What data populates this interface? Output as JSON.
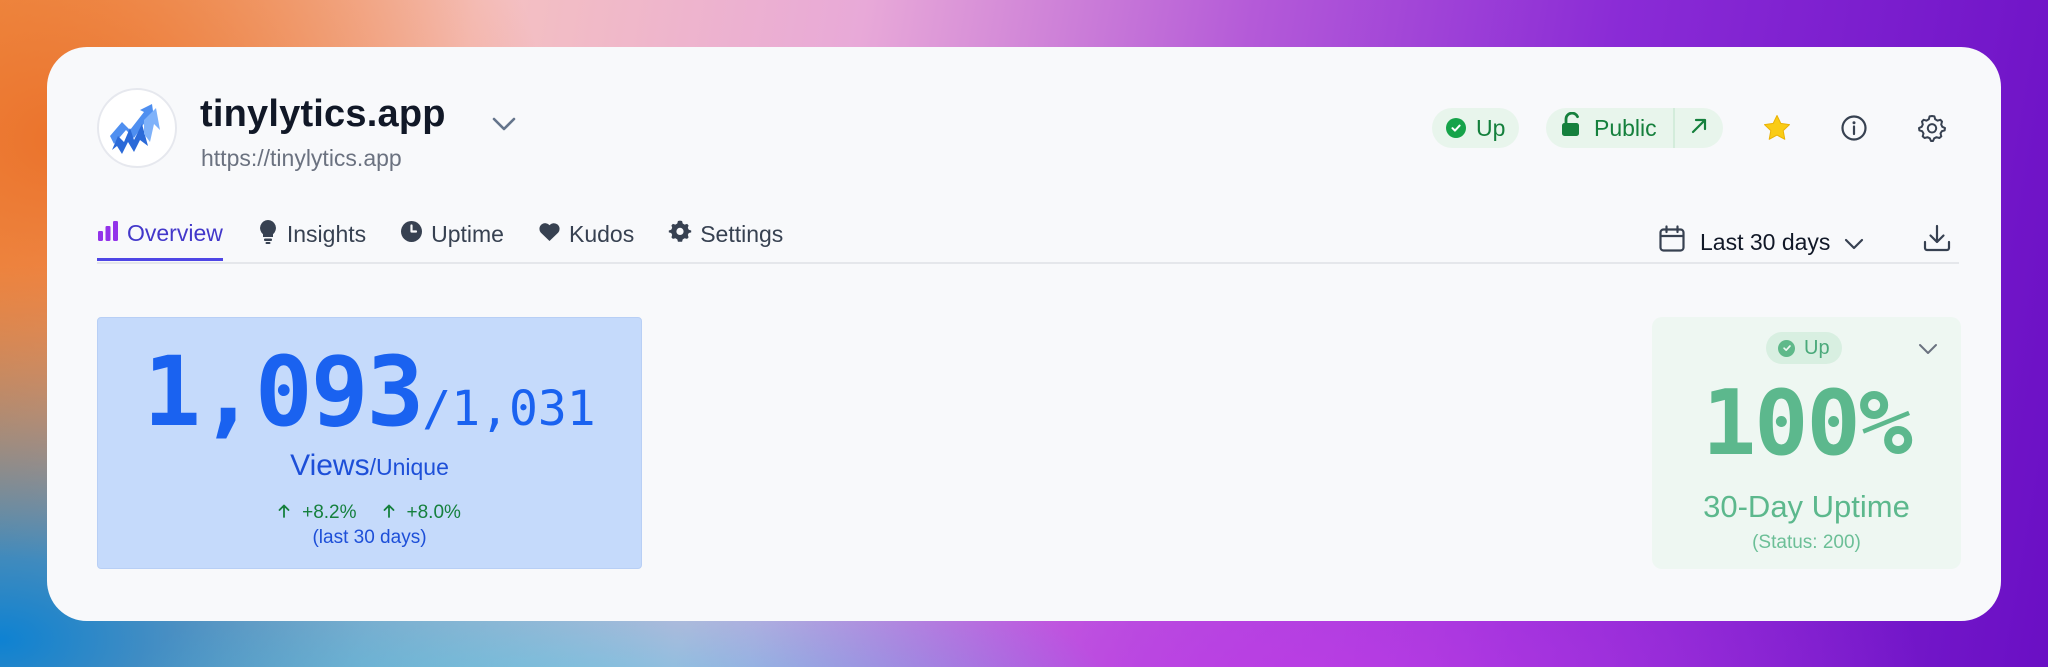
{
  "site": {
    "name": "tinylytics.app",
    "url": "https://tinylytics.app"
  },
  "header": {
    "status_label": "Up",
    "visibility_label": "Public"
  },
  "tabs": [
    {
      "label": "Overview",
      "icon": "bar-chart-icon",
      "active": true
    },
    {
      "label": "Insights",
      "icon": "lightbulb-icon",
      "active": false
    },
    {
      "label": "Uptime",
      "icon": "clock-icon",
      "active": false
    },
    {
      "label": "Kudos",
      "icon": "heart-icon",
      "active": false
    },
    {
      "label": "Settings",
      "icon": "gear-icon",
      "active": false
    }
  ],
  "date_range": {
    "label": "Last 30 days"
  },
  "views": {
    "total": "1,093",
    "unique": "1,031",
    "separator": "/",
    "label_main": "Views",
    "label_sub": "/Unique",
    "total_change": "+8.2%",
    "unique_change": "+8.0%",
    "period": "(last 30 days)"
  },
  "uptime": {
    "status_label": "Up",
    "value": "100%",
    "label": "30-Day Uptime",
    "status_code": "(Status: 200)"
  },
  "colors": {
    "accent": "#4f46e5",
    "success": "#16a34a",
    "views_blue": "#1a62f0",
    "uptime_green": "#5cb88d",
    "star": "#facc15"
  }
}
